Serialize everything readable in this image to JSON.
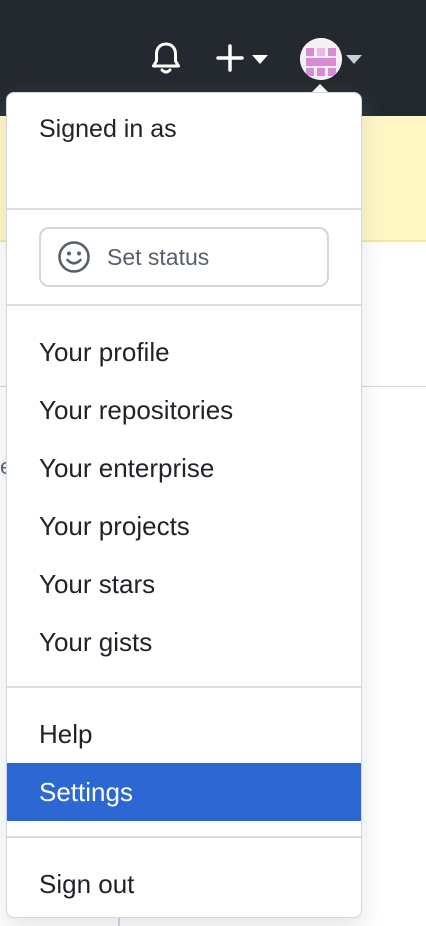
{
  "header": {
    "icons": [
      "bell-icon",
      "plus-icon",
      "caret-down-icon",
      "avatar",
      "caret-down-icon"
    ]
  },
  "menu": {
    "signed_in_label": "Signed in as",
    "status": {
      "label": "Set status",
      "icon": "smiley-icon"
    },
    "items": [
      {
        "label": "Your profile"
      },
      {
        "label": "Your repositories"
      },
      {
        "label": "Your enterprise"
      },
      {
        "label": "Your projects"
      },
      {
        "label": "Your stars"
      },
      {
        "label": "Your gists"
      },
      {
        "label": "Help"
      },
      {
        "label": "Settings",
        "active": true
      },
      {
        "label": "Sign out"
      }
    ]
  },
  "colors": {
    "header_bg": "#24292f",
    "banner_bg": "#fff8c5",
    "active_item_bg": "#2c67d4",
    "avatar_pink": "#d98ad9"
  }
}
